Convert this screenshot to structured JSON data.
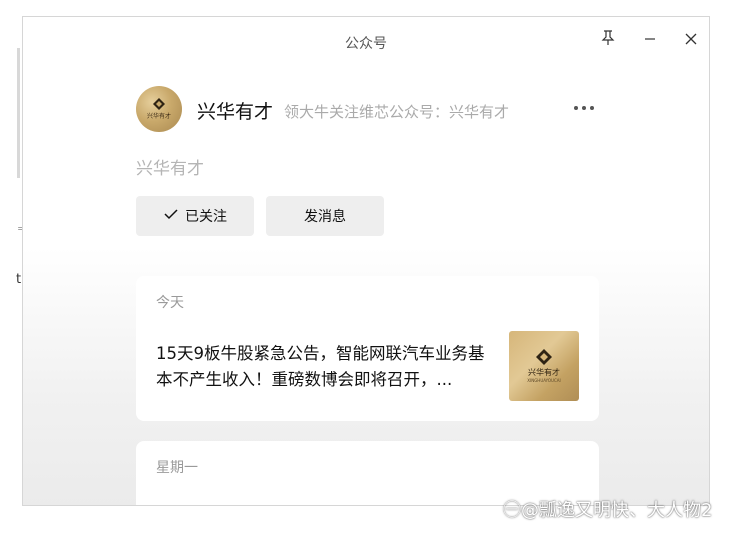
{
  "window": {
    "title": "公众号"
  },
  "account": {
    "name": "兴华有才",
    "description": "领大牛关注维芯公众号：兴华有才",
    "subtitle": "兴华有才",
    "avatar_text": "兴华有才"
  },
  "buttons": {
    "follow_label": "已关注",
    "message_label": "发消息"
  },
  "feed": [
    {
      "day": "今天",
      "title": "15天9板牛股紧急公告，智能网联汽车业务基本不产生收入！重磅数博会即将召开，...",
      "thumb_text": "兴华有才",
      "thumb_small": "XINGHUAYOUCAI"
    },
    {
      "day": "星期一"
    }
  ],
  "watermark": "㊀@瓢逸又明快、大人物2",
  "colors": {
    "accent": "#c9a96b",
    "button_bg": "#eeeeee"
  }
}
